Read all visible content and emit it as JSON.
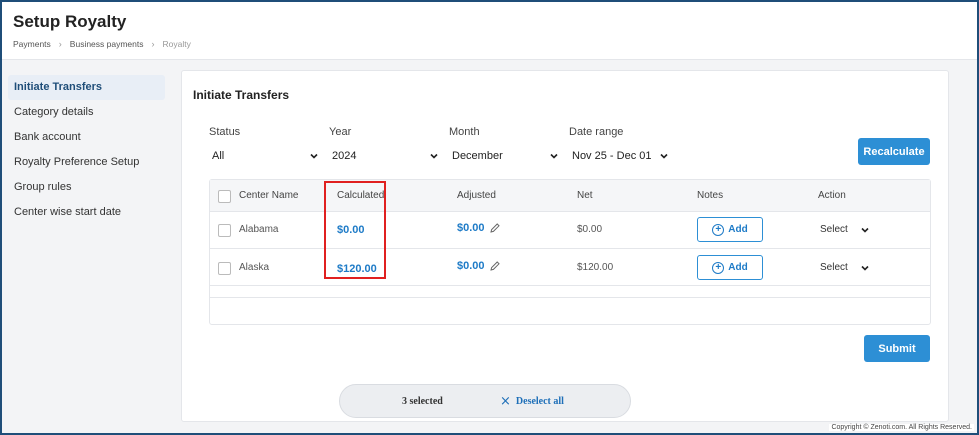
{
  "header": {
    "title": "Setup Royalty",
    "breadcrumb": [
      "Payments",
      "Business payments",
      "Royalty"
    ]
  },
  "sidebar": {
    "items": [
      {
        "label": "Initiate Transfers",
        "active": true
      },
      {
        "label": "Category details"
      },
      {
        "label": "Bank account"
      },
      {
        "label": "Royalty Preference Setup"
      },
      {
        "label": "Group rules"
      },
      {
        "label": "Center wise start date"
      }
    ]
  },
  "main": {
    "title": "Initiate Transfers",
    "filters": {
      "status": {
        "label": "Status",
        "value": "All"
      },
      "year": {
        "label": "Year",
        "value": "2024"
      },
      "month": {
        "label": "Month",
        "value": "December"
      },
      "date_range": {
        "label": "Date range",
        "value": "Nov 25 - Dec 01"
      }
    },
    "recalculate_label": "Recalculate",
    "submit_label": "Submit",
    "table": {
      "headers": [
        "Center Name",
        "Calculated",
        "Adjusted",
        "Net",
        "Notes",
        "Action"
      ],
      "rows": [
        {
          "center": "Alabama",
          "calculated": "$0.00",
          "adjusted": "$0.00",
          "net": "$0.00",
          "notes_label": "Add",
          "action": "Select"
        },
        {
          "center": "Alaska",
          "calculated": "$120.00",
          "adjusted": "$0.00",
          "net": "$120.00",
          "notes_label": "Add",
          "action": "Select"
        }
      ]
    }
  },
  "selection_bar": {
    "count_text": "3  selected",
    "deselect_label": "Deselect  all"
  },
  "footer": {
    "copyright": "Copyright © Zenoti.com. All Rights Reserved."
  },
  "icons": {
    "breadcrumb_separator": "chevron-right-icon",
    "dropdown": "chevron-down-icon",
    "edit": "pencil-icon",
    "add": "plus-circle-icon",
    "deselect": "close-icon"
  },
  "colors": {
    "accent": "#2d8fd5",
    "link": "#1e7bc7",
    "highlight": "#e02020",
    "frame": "#1f4e79"
  }
}
